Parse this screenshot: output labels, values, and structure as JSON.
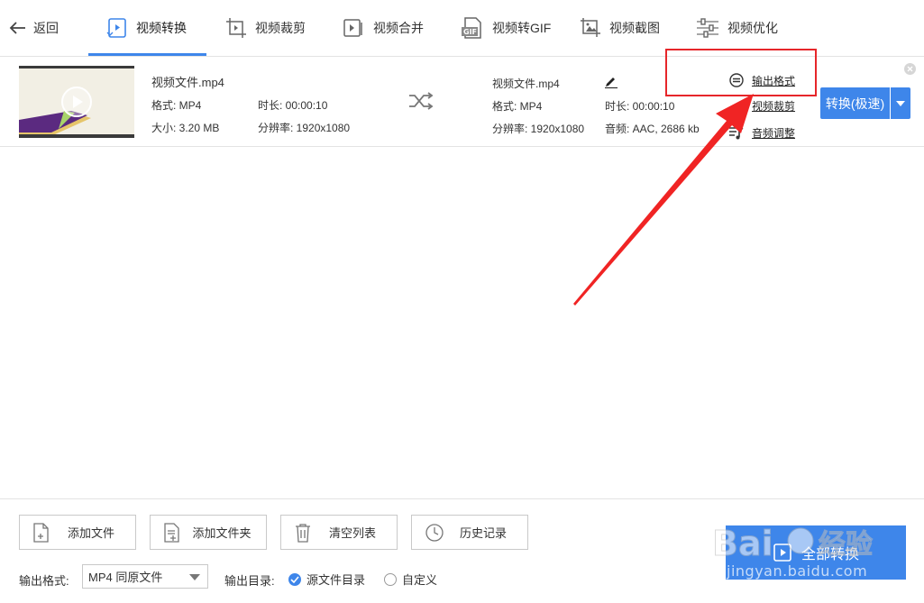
{
  "nav": {
    "back_label": "返回",
    "tabs": [
      {
        "label": "视频转换",
        "icon": "video-convert-icon",
        "active": true
      },
      {
        "label": "视频裁剪",
        "icon": "video-crop-icon",
        "active": false
      },
      {
        "label": "视频合并",
        "icon": "video-merge-icon",
        "active": false
      },
      {
        "label": "视频转GIF",
        "icon": "gif-icon",
        "active": false
      },
      {
        "label": "视频截图",
        "icon": "image-icon",
        "active": false
      },
      {
        "label": "视频优化",
        "icon": "sliders-icon",
        "active": false
      }
    ]
  },
  "file": {
    "source": {
      "name": "视频文件.mp4",
      "format": "格式: MP4",
      "duration": "时长: 00:00:10",
      "size": "大小: 3.20 MB",
      "resolution": "分辨率: 1920x1080"
    },
    "output": {
      "name": "视频文件.mp4",
      "format": "格式: MP4",
      "duration": "时长: 00:00:10",
      "resolution": "分辨率: 1920x1080",
      "audio": "音频: AAC, 2686 kb"
    },
    "options": {
      "output_format": "输出格式",
      "video_crop": "视频裁剪",
      "audio_adjust": "音频调整"
    },
    "convert_button": "转换(极速)"
  },
  "bottom": {
    "add_file": "添加文件",
    "add_folder": "添加文件夹",
    "clear_list": "清空列表",
    "history": "历史记录",
    "output_format_label": "输出格式:",
    "output_format_value": "MP4 同原文件",
    "output_dir_label": "输出目录:",
    "dir_source": "源文件目录",
    "dir_custom": "自定义",
    "convert_all": "全部转换"
  },
  "watermark": {
    "text": "jingyan.baidu.com"
  },
  "colors": {
    "accent": "#3e86ea",
    "annotation": "#e6262a"
  }
}
